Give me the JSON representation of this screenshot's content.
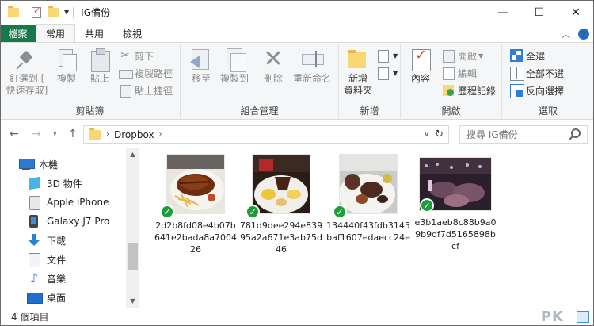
{
  "window": {
    "title": "IG備份",
    "quick_access": [
      "folder-icon",
      "properties-icon",
      "folder-icon",
      "dropdown-icon"
    ],
    "buttons": {
      "minimize": "—",
      "maximize": "☐",
      "close": "✕"
    }
  },
  "tabs": {
    "file": "檔案",
    "home": "常用",
    "share": "共用",
    "view": "檢視"
  },
  "ribbon": {
    "clipboard": {
      "label": "剪貼簿",
      "pin": "釘選到 [",
      "pin2": "快速存取]",
      "copy": "複製",
      "paste": "貼上",
      "cut": "剪下",
      "copy_path": "複製路徑",
      "paste_shortcut": "貼上捷徑"
    },
    "organize": {
      "label": "組合管理",
      "move_to": "移至",
      "copy_to": "複製到",
      "delete": "刪除",
      "rename": "重新命名"
    },
    "new": {
      "label": "新增",
      "new_folder": "新增",
      "new_folder2": "資料夾"
    },
    "open": {
      "label": "開啟",
      "properties": "內容",
      "open": "開啟",
      "edit": "編輯",
      "history": "歷程記錄"
    },
    "select": {
      "label": "選取",
      "select_all": "全選",
      "select_none": "全部不選",
      "invert": "反向選擇"
    }
  },
  "address": {
    "crumb": "Dropbox",
    "search_placeholder": "搜尋 IG備份"
  },
  "sidebar": {
    "items": [
      {
        "label": "本機",
        "icon": "pc-icon"
      },
      {
        "label": "3D 物件",
        "icon": "3d-objects-icon"
      },
      {
        "label": "Apple iPhone",
        "icon": "iphone-icon"
      },
      {
        "label": "Galaxy J7 Pro",
        "icon": "android-phone-icon"
      },
      {
        "label": "下載",
        "icon": "download-icon"
      },
      {
        "label": "文件",
        "icon": "documents-icon"
      },
      {
        "label": "音樂",
        "icon": "music-icon"
      },
      {
        "label": "桌面",
        "icon": "desktop-icon"
      }
    ]
  },
  "files": [
    {
      "name": "2d2b8fd08e4b07b641e2bada8a700426",
      "synced": true
    },
    {
      "name": "781d9dee294e83995a2a671e3ab75d46",
      "synced": true
    },
    {
      "name": "134440f43fdb3145baf1607edaecc24e",
      "synced": true
    },
    {
      "name": "e3b1aeb8c88b9a09b9df7d5165898bcf",
      "synced": true
    }
  ],
  "status": {
    "count": "4 個項目",
    "watermark": "PK"
  },
  "colors": {
    "file_tab": "#19784a",
    "sync_ok": "#1f9d3a",
    "accent": "#2f7ed8"
  }
}
